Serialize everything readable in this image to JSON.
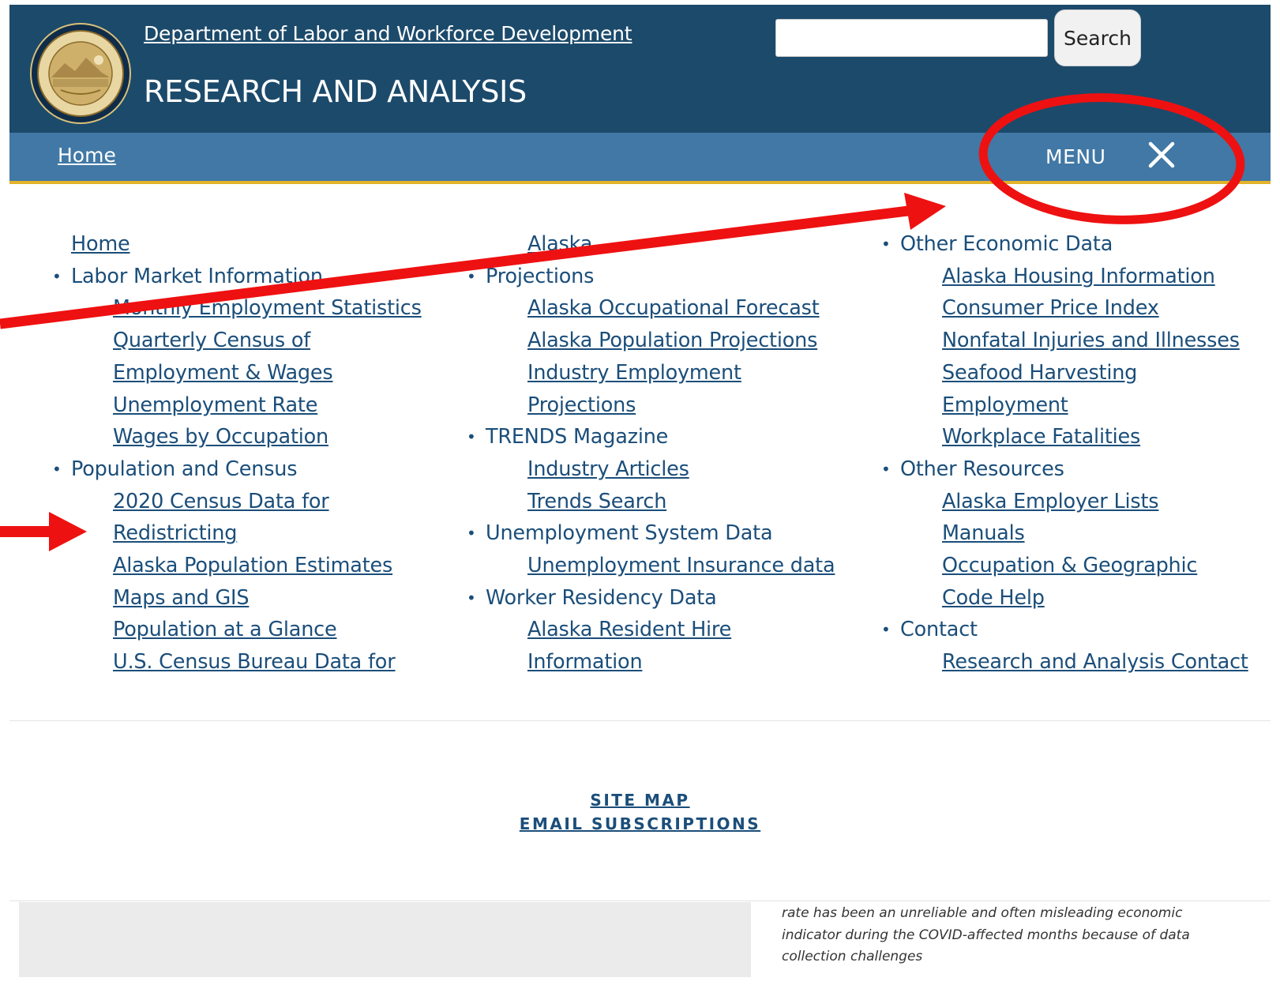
{
  "header": {
    "department_link": "Department of Labor and Workforce Development",
    "site_title": "RESEARCH AND ANALYSIS",
    "search_value": "",
    "search_button": "Search"
  },
  "navbar": {
    "home_label": "Home",
    "menu_label": "MENU"
  },
  "menu": {
    "col1": {
      "home": "Home",
      "lmi_heading": "Labor Market Information",
      "lmi_items": [
        "Monthly Employment Statistics",
        "Quarterly Census of",
        "Employment & Wages",
        "Unemployment Rate",
        "Wages by Occupation"
      ],
      "pop_heading": "Population and Census",
      "pop_items": [
        "2020 Census Data for",
        "Redistricting",
        "Alaska Population Estimates",
        "Maps and GIS",
        "Population at a Glance",
        "U.S. Census Bureau Data for"
      ]
    },
    "col2": {
      "overflow_item": "Alaska",
      "proj_heading": "Projections",
      "proj_items": [
        "Alaska Occupational Forecast",
        "Alaska Population Projections",
        "Industry Employment",
        "Projections"
      ],
      "trends_heading": "TRENDS Magazine",
      "trends_items": [
        "Industry Articles",
        "Trends Search"
      ],
      "unemp_heading": "Unemployment System Data",
      "unemp_items": [
        "Unemployment Insurance data"
      ],
      "worker_heading": "Worker Residency Data",
      "worker_items": [
        "Alaska Resident Hire",
        "Information"
      ]
    },
    "col3": {
      "econ_heading": "Other Economic Data",
      "econ_items": [
        "Alaska Housing Information",
        "Consumer Price Index",
        "Nonfatal Injuries and Illnesses",
        "Seafood Harvesting",
        "Employment",
        "Workplace Fatalities"
      ],
      "res_heading": "Other Resources",
      "res_items": [
        "Alaska Employer Lists",
        "Manuals",
        "Occupation & Geographic",
        "Code Help"
      ],
      "contact_heading": "Contact",
      "contact_items": [
        "Research and Analysis Contact"
      ]
    }
  },
  "footer": {
    "site_map": "SITE MAP",
    "email_subscriptions": "EMAIL SUBSCRIPTIONS"
  },
  "content": {
    "note_text": "rate has been an unreliable and often misleading economic indicator during the COVID-affected months because of data collection challenges"
  },
  "colors": {
    "header_bg": "#1c4a6b",
    "navbar_bg": "#4178a5",
    "navbar_border": "#e1b22a",
    "link": "#1b4e7a",
    "annotation": "#ee1111"
  },
  "icons": {
    "seal": "state-seal-icon",
    "close": "close-icon"
  }
}
